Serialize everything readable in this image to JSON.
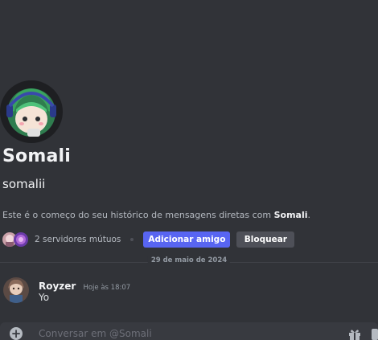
{
  "profile": {
    "display_name": "Somali",
    "username": "somalii",
    "intro_prefix": "Este é o começo do seu histórico de mensagens diretas com ",
    "intro_name": "Somali",
    "intro_suffix": ".",
    "mutual_servers": "2 servidores mútuos",
    "add_friend_label": "Adicionar amigo",
    "block_label": "Bloquear"
  },
  "divider": {
    "date": "29 de maio de 2024"
  },
  "messages": [
    {
      "author": "Royzer",
      "timestamp": "Hoje às 18:07",
      "text": "Yo"
    }
  ],
  "composer": {
    "placeholder": "Conversar em @Somali"
  },
  "colors": {
    "background": "#313338",
    "primary_button": "#5865f2",
    "secondary_button": "#4e5058",
    "composer_bg": "#383a40"
  },
  "icons": {
    "add": "plus-circle-icon",
    "gift": "gift-icon"
  }
}
